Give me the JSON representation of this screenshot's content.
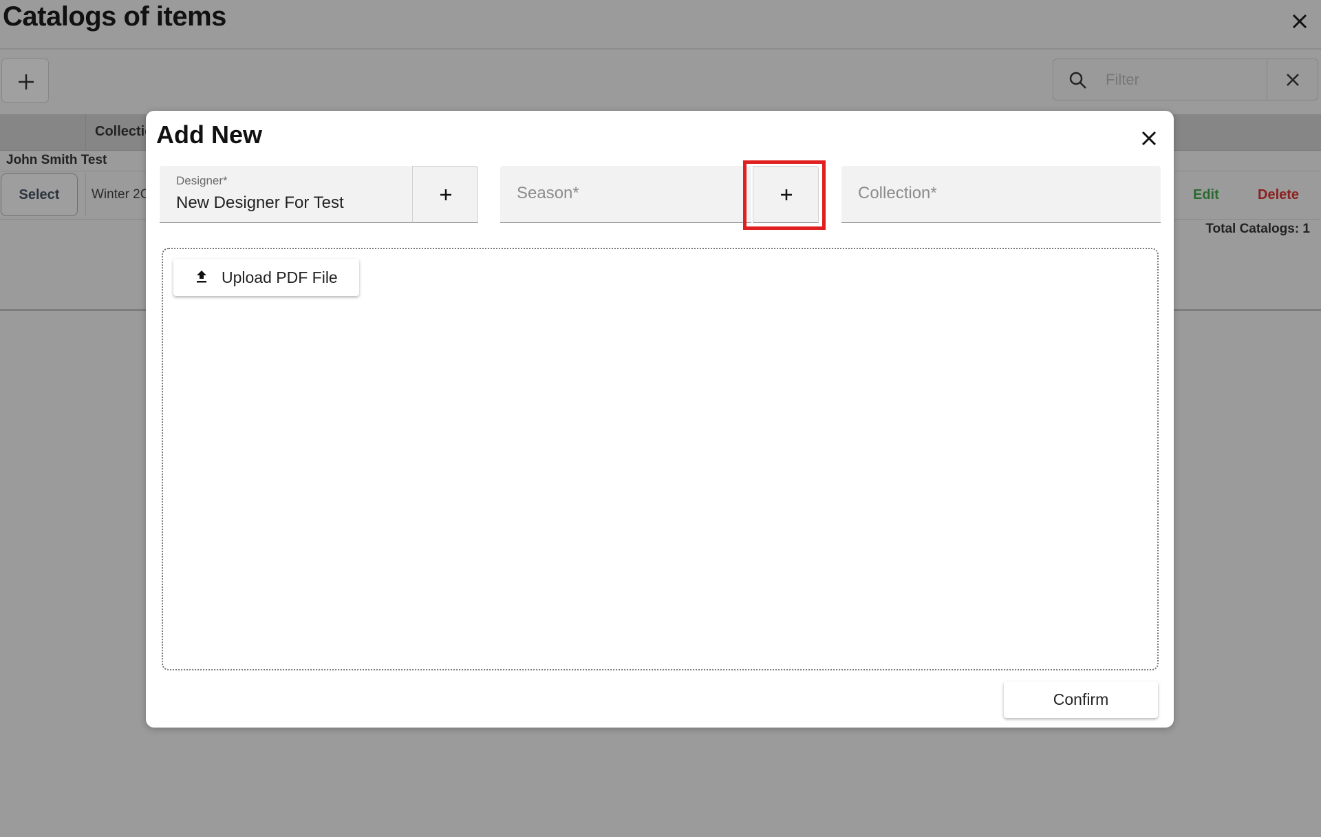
{
  "page": {
    "title": "Catalogs of items",
    "filter": {
      "placeholder": "Filter"
    }
  },
  "table": {
    "column_collection": "Collectic",
    "group_label": "John Smith Test",
    "row": {
      "select_label": "Select",
      "collection": "Winter 2C",
      "edit_label": "Edit",
      "delete_label": "Delete"
    },
    "total": "Total Catalogs: 1"
  },
  "modal": {
    "title": "Add New",
    "designer": {
      "label": "Designer*",
      "value": "New Designer For Test"
    },
    "season": {
      "placeholder": "Season*"
    },
    "collection": {
      "placeholder": "Collection*"
    },
    "upload_label": "Upload PDF File",
    "confirm_label": "Confirm"
  },
  "colors": {
    "overlay": "#9b9b9b",
    "highlight": "#e02020",
    "edit": "#2b6b2f",
    "delete": "#8c1f1f"
  },
  "icons": [
    "close-icon",
    "plus-icon",
    "search-icon",
    "upload-icon"
  ]
}
